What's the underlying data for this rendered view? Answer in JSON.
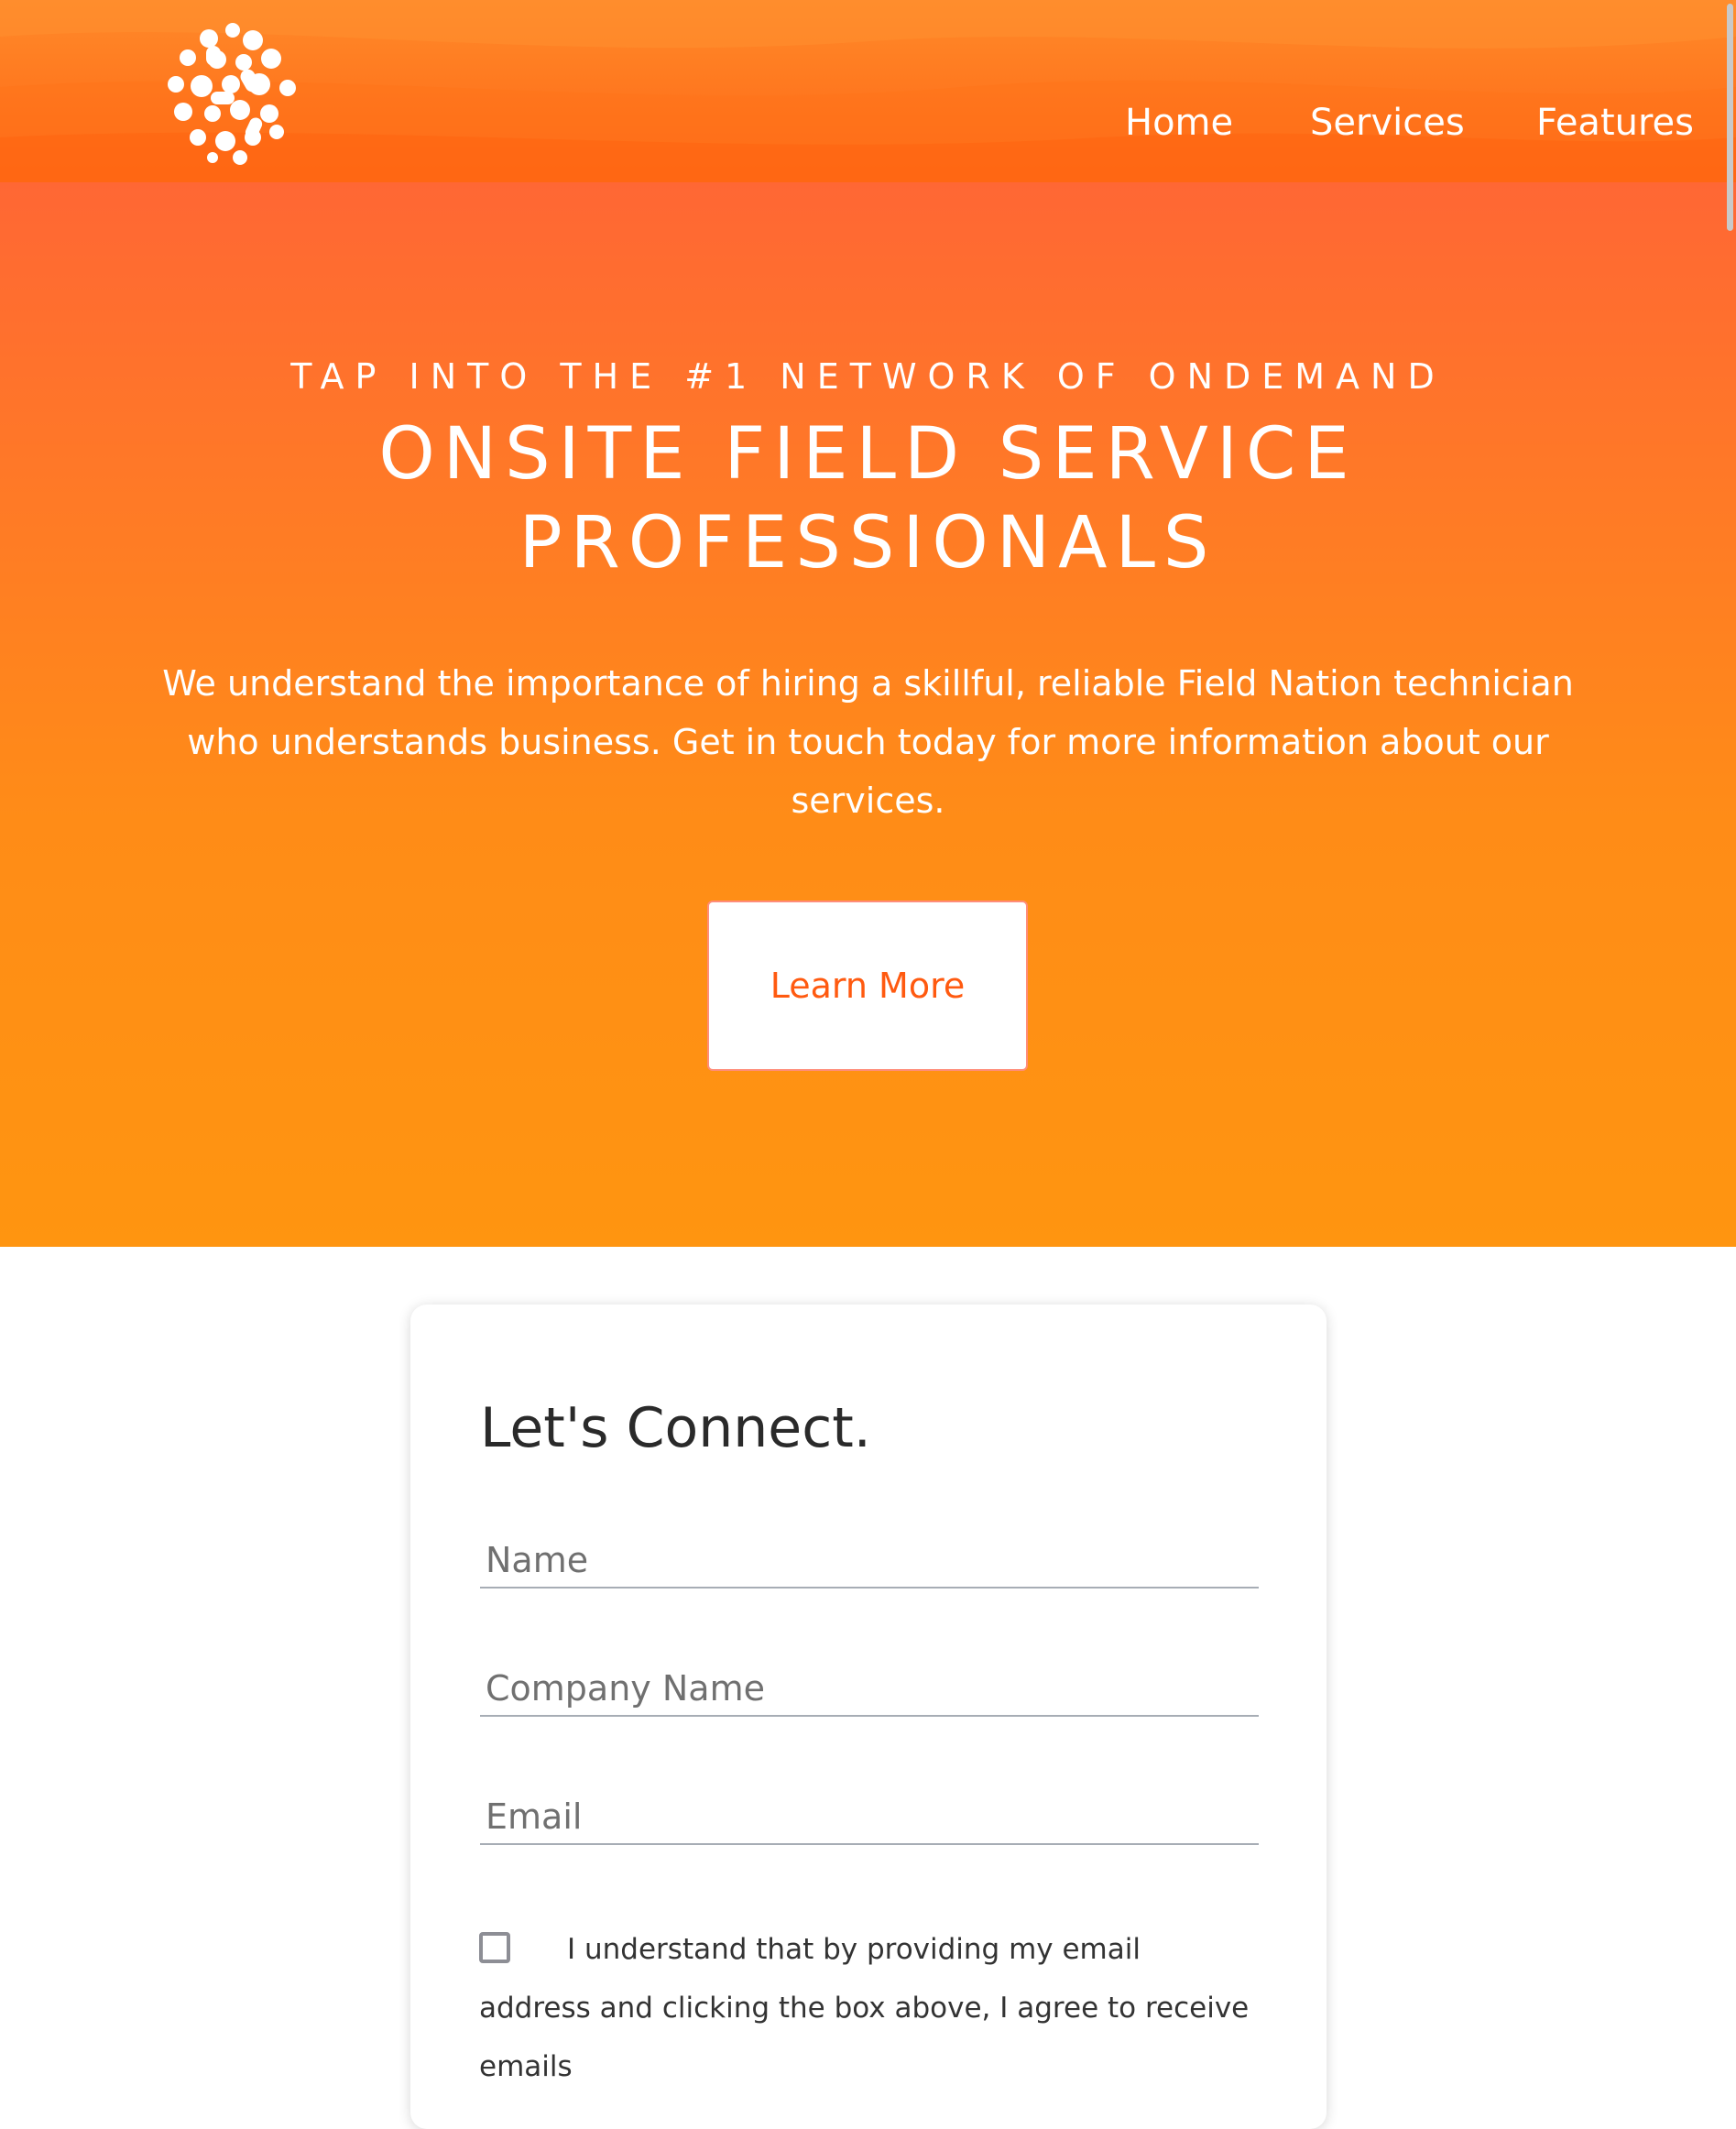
{
  "nav": {
    "home": "Home",
    "services": "Services",
    "features": "Features"
  },
  "hero": {
    "pretitle": "TAP INTO THE #1 NETWORK OF ONDEMAND",
    "title": "ONSITE FIELD SERVICE PROFESSIONALS",
    "description": "We understand the importance of hiring a skillful, reliable Field Nation technician who understands business. Get in touch today for more information about our services.",
    "cta_label": "Learn More"
  },
  "contact": {
    "title": "Let's Connect.",
    "name_placeholder": "Name",
    "company_placeholder": "Company Name",
    "email_placeholder": "Email",
    "consent_text": "I understand that by providing my email address and clicking the box above, I agree to receive emails"
  },
  "colors": {
    "header_orange": "#ff7a20",
    "hero_top": "#ff6734",
    "hero_bottom": "#ff9510",
    "cta_text": "#ff5a10"
  },
  "icons": {
    "logo": "blob-sphere-logo"
  }
}
